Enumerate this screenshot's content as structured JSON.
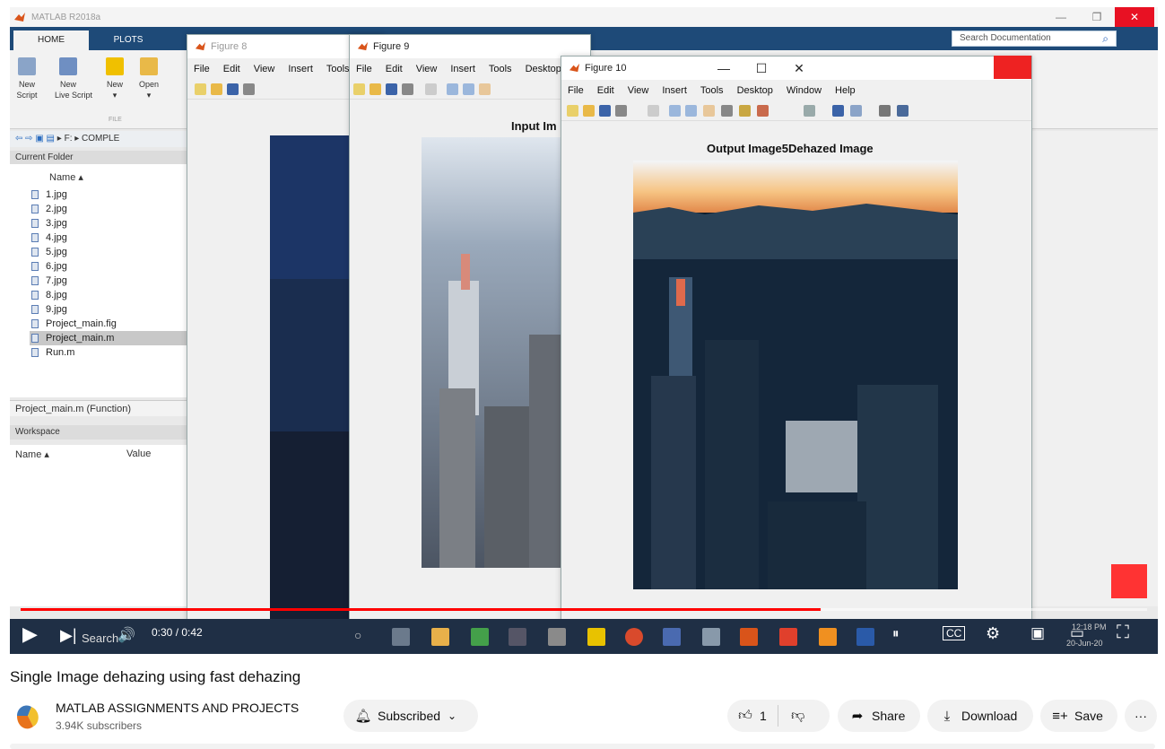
{
  "matlab": {
    "window_title": "MATLAB R2018a",
    "tabs": [
      "HOME",
      "PLOTS"
    ],
    "ribbon_buttons": [
      {
        "label1": "New",
        "label2": "Script",
        "color": "#8aa4c8"
      },
      {
        "label1": "New",
        "label2": "Live Script",
        "color": "#6f8fc2"
      },
      {
        "label1": "New",
        "label2": "▾",
        "color": "#f0c000"
      },
      {
        "label1": "Open",
        "label2": "▾",
        "color": "#e9b948"
      }
    ],
    "ribbon_section": "FILE",
    "search_docs": "Search Documentation",
    "path": "▸ F: ▸ COMPLE",
    "current_folder_label": "Current Folder",
    "name_col": "Name ▴",
    "files": [
      "1.jpg",
      "2.jpg",
      "3.jpg",
      "4.jpg",
      "5.jpg",
      "6.jpg",
      "7.jpg",
      "8.jpg",
      "9.jpg",
      "Project_main.fig",
      "Project_main.m",
      "Run.m"
    ],
    "selected_file_index": 10,
    "function_bar": "Project_main.m  (Function)",
    "workspace_label": "Workspace",
    "ws_name_col": "Name ▴",
    "ws_value_col": "Value"
  },
  "figures": {
    "fig8": {
      "title": "Figure 8",
      "menu": [
        "File",
        "Edit",
        "View",
        "Insert",
        "Tools"
      ]
    },
    "fig9": {
      "title": "Figure 9",
      "menu": [
        "File",
        "Edit",
        "View",
        "Insert",
        "Tools",
        "Desktop"
      ],
      "plot_title": "Input Im"
    },
    "fig10": {
      "title": "Figure 10",
      "menu": [
        "File",
        "Edit",
        "View",
        "Insert",
        "Tools",
        "Desktop",
        "Window",
        "Help"
      ],
      "plot_title": "Output Image5Dehazed Image"
    }
  },
  "player": {
    "time": "0:30 / 0:42",
    "progress": 0.71,
    "search_text": "Search",
    "clock_time": "12:18 PM",
    "clock_date": "20-Jun-20"
  },
  "video": {
    "title": "Single Image dehazing using fast dehazing",
    "channel": "MATLAB ASSIGNMENTS AND PROJECTS",
    "subscribers": "3.94K subscribers",
    "subscribe_label": "Subscribed",
    "likes": "1",
    "share_label": "Share",
    "download_label": "Download",
    "save_label": "Save",
    "more_label": "···"
  },
  "colors": {
    "youtube_red": "#ff0000",
    "matlab_ribbon": "#1e4a78",
    "taskbar": "#1f2f45"
  }
}
